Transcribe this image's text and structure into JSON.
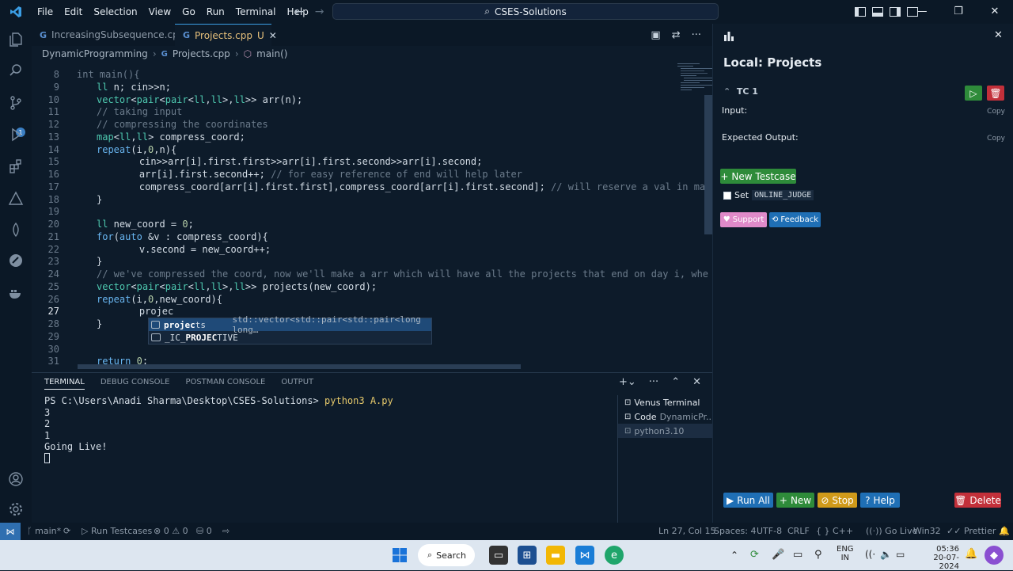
{
  "menu": [
    "File",
    "Edit",
    "Selection",
    "View",
    "Go",
    "Run",
    "Terminal",
    "Help"
  ],
  "search_bar": "CSES-Solutions",
  "tabs": [
    {
      "label": "IncreasingSubsequence.cpp",
      "active": false
    },
    {
      "label": "Projects.cpp",
      "active": true,
      "status": "U"
    }
  ],
  "breadcrumb": [
    "DynamicProgramming",
    "Projects.cpp",
    "main()"
  ],
  "editor": {
    "header_fragment": "int main(){",
    "lines": [
      {
        "n": "8",
        "code": ""
      },
      {
        "n": "9",
        "code": "    ll n; cin>>n;"
      },
      {
        "n": "10",
        "code": "    vector<pair<pair<ll,ll>,ll>> arr(n);"
      },
      {
        "n": "11",
        "code": "    // taking input"
      },
      {
        "n": "12",
        "code": "    // compressing the coordinates"
      },
      {
        "n": "13",
        "code": "    map<ll,ll> compress_coord;"
      },
      {
        "n": "14",
        "code": "    repeat(i,0,n){"
      },
      {
        "n": "15",
        "code": "        cin>>arr[i].first.first>>arr[i].first.second>>arr[i].second;"
      },
      {
        "n": "16",
        "code": "        arr[i].first.second++; // for easy reference of end will help later"
      },
      {
        "n": "17",
        "code": "        compress_coord[arr[i].first.first],compress_coord[arr[i].first.second]; // will reserve a val in map"
      },
      {
        "n": "18",
        "code": "    }"
      },
      {
        "n": "19",
        "code": ""
      },
      {
        "n": "20",
        "code": "    ll new_coord = 0;"
      },
      {
        "n": "21",
        "code": "    for(auto &v : compress_coord){"
      },
      {
        "n": "22",
        "code": "        v.second = new_coord++;"
      },
      {
        "n": "23",
        "code": "    }"
      },
      {
        "n": "24",
        "code": "    // we've compressed the coord, now we'll make a arr which will have all the projects that end on day i, whe"
      },
      {
        "n": "25",
        "code": "    vector<pair<pair<ll,ll>,ll>> projects(new_coord);"
      },
      {
        "n": "26",
        "code": "    repeat(i,0,new_coord){"
      },
      {
        "n": "27",
        "code": "        projec"
      },
      {
        "n": "28",
        "code": "    }"
      },
      {
        "n": "29",
        "code": ""
      },
      {
        "n": "30",
        "code": ""
      },
      {
        "n": "31",
        "code": "    return 0;"
      }
    ],
    "current_line": "27"
  },
  "suggestions": [
    {
      "match": "projec",
      "rest": "ts",
      "detail": "std::vector<std::pair<std::pair<long long…"
    },
    {
      "prefix": "_IC_",
      "match": "PROJEC",
      "rest": "TIVE",
      "detail": ""
    }
  ],
  "panel": {
    "tabs": [
      "TERMINAL",
      "DEBUG CONSOLE",
      "POSTMAN CONSOLE",
      "OUTPUT"
    ],
    "terminal_lines": [
      {
        "prompt": "PS C:\\Users\\Anadi Sharma\\Desktop\\CSES-Solutions>",
        "cmd": "python3 A.py"
      },
      {
        "text": "3"
      },
      {
        "text": "2"
      },
      {
        "text": "1"
      },
      {
        "text": "Going Live!"
      }
    ],
    "terminals": [
      {
        "label": "Venus Terminal",
        "detail": ""
      },
      {
        "label": "Code",
        "detail": "DynamicPr..."
      },
      {
        "label": "python3.10",
        "detail": ""
      }
    ]
  },
  "side_panel": {
    "title": "Local: Projects",
    "testcase": "TC 1",
    "input_label": "Input:",
    "expected_label": "Expected Output:",
    "copy_label": "Copy",
    "new_testcase": "New Testcase",
    "set_label": "Set",
    "online_judge": "ONLINE_JUDGE",
    "support": "Support",
    "feedback": "Feedback",
    "run_all": "Run All",
    "new": "New",
    "stop": "Stop",
    "help": "Help",
    "delete": "Delete",
    "colors": {
      "run": "#2e8b3a",
      "delete": "#c2303a",
      "blue": "#1f6fb5",
      "green": "#2e8b3a",
      "yellow": "#d09a1a",
      "pink": "#e08ac9"
    }
  },
  "status_bar": {
    "branch": "main*",
    "run_testcases": "Run Testcases",
    "errors": "0",
    "warnings": "0",
    "ports": "0",
    "position": "Ln 27, Col 15",
    "spaces": "Spaces: 4",
    "encoding": "UTF-8",
    "eol": "CRLF",
    "language": "C++",
    "go_live": "Go Live",
    "platform": "Win32",
    "prettier": "Prettier"
  },
  "taskbar": {
    "search": "Search",
    "lang": "ENG",
    "region": "IN",
    "time": "05:36",
    "date": "20-07-2024"
  }
}
